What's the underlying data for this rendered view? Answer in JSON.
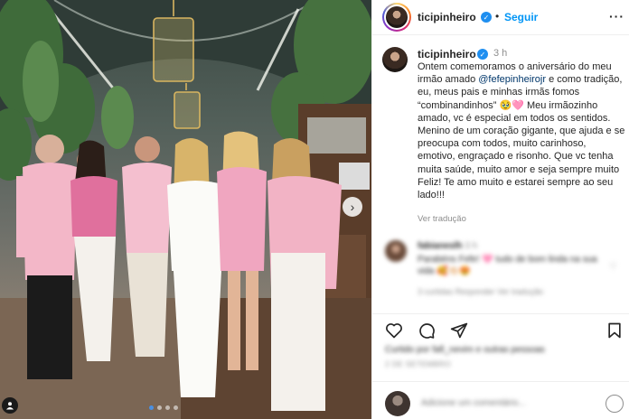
{
  "header": {
    "username": "ticipinheiro",
    "follow_label": "Seguir",
    "more_label": "···"
  },
  "caption": {
    "username": "ticipinheiro",
    "time": "3 h",
    "text_part1": "Ontem comemoramos o aniversário do meu irmão amado ",
    "mention": "@fefepinheirojr",
    "text_part2": " e como tradição, eu, meus pais e minhas irmãs fomos “combinandinhos” 🥹🩷 Meu irmãozinho amado, vc é especial em todos os sentidos. Menino de um coração gigante, que ajuda e se preocupa com todos, muito carinhoso, emotivo, engraçado e risonho. Que vc tenha muita saúde, muito amor e seja sempre muito Feliz! Te amo muito e estarei sempre ao seu lado!!!",
    "translate_label": "Ver tradução"
  },
  "comment": {
    "username": "fabianeslh",
    "time": "3 h",
    "text": "Parabéns Fefe! 🩷 tudo de bom linda na sua vida 🥰👏🏻😍",
    "meta": "3 curtidas   Responder   Ver tradução"
  },
  "likes_text": "Curtido por fafi_nevim e outras pessoas",
  "date_text": "2 DE SETEMBRO",
  "add_comment_placeholder": "Adicione um comentário...",
  "colors": {
    "accent": "#0095f6",
    "verified": "#1f8ff0",
    "mention": "#00376b",
    "secondary_text": "#8e8e8e"
  },
  "icons": [
    "verified-icon",
    "more-icon",
    "heart-icon",
    "comment-icon",
    "share-icon",
    "bookmark-icon",
    "chevron-right-icon",
    "user-tag-icon",
    "emoji-icon"
  ],
  "carousel": {
    "count": 4,
    "active": 1
  }
}
